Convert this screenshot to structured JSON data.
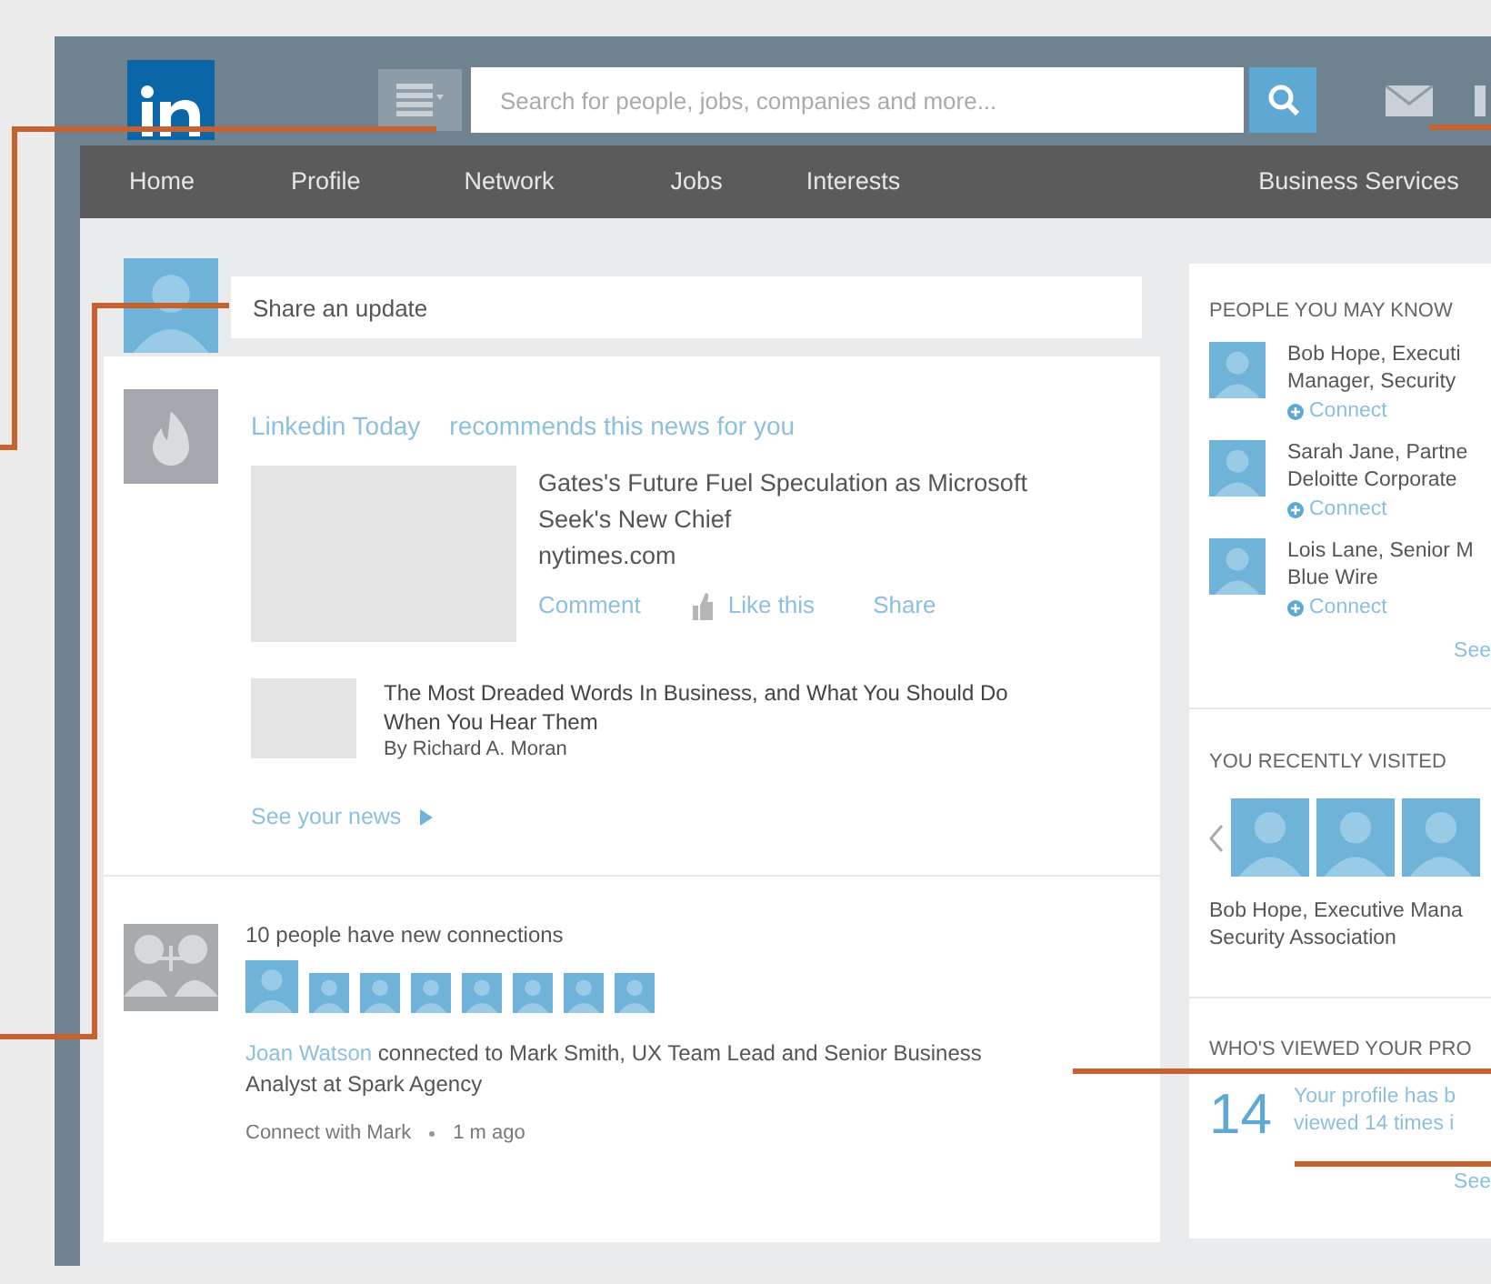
{
  "header": {
    "search": {
      "placeholder": "Search for people, jobs, companies and more..."
    }
  },
  "nav": [
    {
      "label": "Home"
    },
    {
      "label": "Profile"
    },
    {
      "label": "Network"
    },
    {
      "label": "Jobs"
    },
    {
      "label": "Interests"
    },
    {
      "label": "Business Services"
    }
  ],
  "share": {
    "placeholder": "Share an update"
  },
  "news": {
    "source": "Linkedin Today",
    "tagline": "recommends this news for you",
    "headline": "Gates's Future Fuel Speculation as Microsoft Seek's New Chief",
    "site": "nytimes.com",
    "actions": [
      "Comment",
      "Like this",
      "Share"
    ],
    "second": {
      "title": "The Most Dreaded Words In Business, and What You Should Do When You Hear Them",
      "byline": "By Richard A. Moran"
    },
    "more": "See your news"
  },
  "connections": {
    "title": "10 people have new connections",
    "name": "Joan Watson",
    "text": "connected to Mark Smith, UX Team Lead and Senior Business Analyst at Spark Agency",
    "action": "Connect with Mark",
    "time": "1 m ago"
  },
  "people": {
    "title": "PEOPLE YOU MAY KNOW",
    "items": [
      {
        "lines": [
          "Bob Hope, Executi",
          "Manager, Security"
        ],
        "action": "Connect"
      },
      {
        "lines": [
          "Sarah Jane, Partne",
          "Deloitte Corporate"
        ],
        "action": "Connect"
      },
      {
        "lines": [
          "Lois Lane, Senior M",
          "Blue Wire"
        ],
        "action": "Connect"
      }
    ],
    "more": "See"
  },
  "visited": {
    "title": "YOU RECENTLY VISITED",
    "lines": [
      "Bob Hope, Executive Mana",
      "Security Association"
    ]
  },
  "viewed": {
    "title": "WHO'S VIEWED YOUR PRO",
    "count": "14",
    "lines": [
      "Your profile has b",
      "viewed 14 times i"
    ],
    "more": "See"
  }
}
